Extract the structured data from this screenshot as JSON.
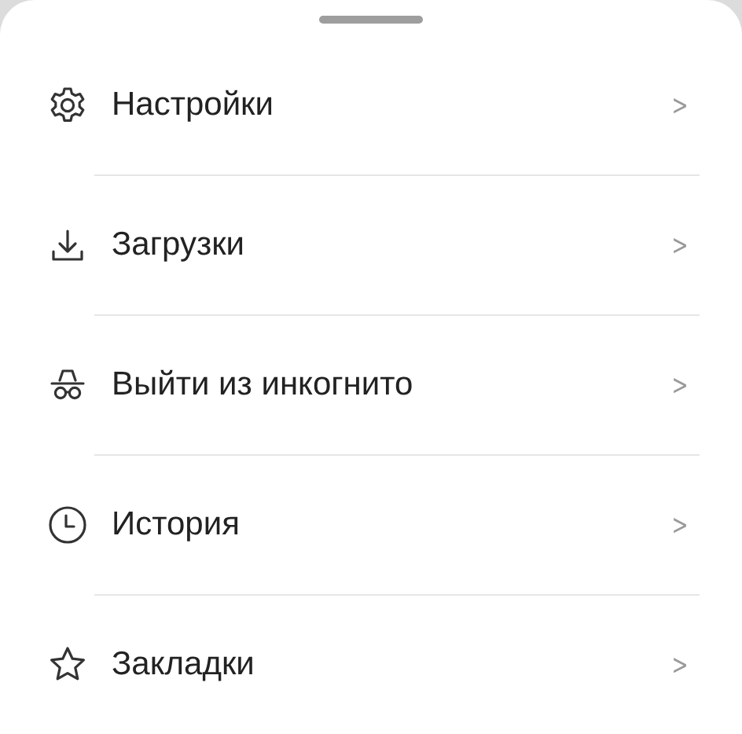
{
  "menu": {
    "items": [
      {
        "kind": "settings",
        "label": "Настройки",
        "chevron": ">"
      },
      {
        "kind": "downloads",
        "label": "Загрузки",
        "chevron": ">"
      },
      {
        "kind": "incognito",
        "label": "Выйти из инкогнито",
        "chevron": ">"
      },
      {
        "kind": "history",
        "label": "История",
        "chevron": ">"
      },
      {
        "kind": "bookmarks",
        "label": "Закладки",
        "chevron": ">"
      }
    ]
  }
}
